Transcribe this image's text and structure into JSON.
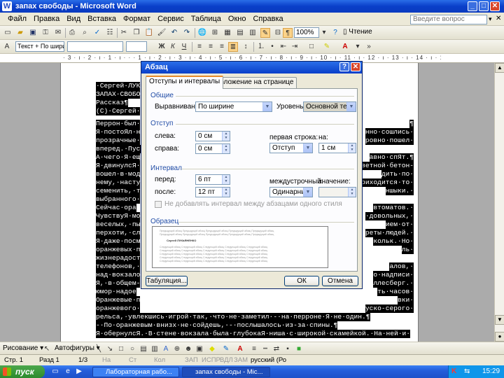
{
  "window": {
    "title": "запах свободы - Microsoft Word"
  },
  "menu": {
    "items": [
      "Файл",
      "Правка",
      "Вид",
      "Вставка",
      "Формат",
      "Сервис",
      "Таблица",
      "Окно",
      "Справка"
    ],
    "ask_placeholder": "Введите вопрос"
  },
  "toolbar": {
    "zoom": "100%",
    "reading": "Чтение",
    "style": "Текст + По шири"
  },
  "ruler": {
    "labels": "· 3 · ı · 2 · ı · 1 · ı · · · 1 · ı · 2 · ı · 3 · ı · 4 · ı · 5 · ı · 6 · ı · 7 · ı · 8 · ı · 9 · ı · 10 · ı · 11 · ı · 12 · ı · 13 · ı · 14 · ı · 15 · ı · 16 · ı · 18"
  },
  "document": {
    "lines": [
      {
        "text": "·Сергей·ЛУК",
        "sel": true
      },
      {
        "text": "ЗАПАХ·СВОБО",
        "sel": true
      },
      {
        "text": "Рассказ¶",
        "sel": true
      },
      {
        "text": "(С)·Сергей·",
        "sel": true
      },
      {
        "text": "Перрон·был·",
        "sel": true,
        "right": "¶"
      },
      {
        "text": "Я·постоЯл·н",
        "sel": true,
        "right": "нно·сошлись·"
      },
      {
        "text": "прозрачные·",
        "sel": true,
        "right": "ровно·пошел·"
      },
      {
        "text": "вперед.·Пуст",
        "sel": true,
        "right": ""
      },
      {
        "text": "А·чего·Я·ещ",
        "sel": true,
        "right": "авно·спЯт.¶"
      },
      {
        "text": "Я·двинулсЯ·",
        "sel": true,
        "right": "светной·бетон-"
      },
      {
        "text": "вошел·в·мод",
        "sel": true,
        "right": "дить·по·"
      },
      {
        "text": "нему,·насту",
        "sel": true,
        "right": "риходится·то·"
      },
      {
        "text": "семенить,·т",
        "sel": true,
        "right": "ншыки.·"
      },
      {
        "text": "выбранного·",
        "sel": true,
        "right": ""
      },
      {
        "text": "Сейчас·ора",
        "sel": true,
        "right": "втоматов.·"
      },
      {
        "text": "ЧувствуЯ·мо",
        "sel": true,
        "right": "·довольных,·"
      },
      {
        "text": "веселых,·пы",
        "sel": true,
        "right": "ием·от·"
      },
      {
        "text": "перхоти,·сл",
        "sel": true,
        "right": "реты·людей.·"
      },
      {
        "text": "Я·даже·посм",
        "sel": true,
        "right": "кольк.·Но·"
      },
      {
        "text": "оранжевых·п",
        "sel": true,
        "right": "ль·"
      },
      {
        "text": "жизнерадост",
        "sel": true,
        "right": ""
      },
      {
        "text": "телефонов,·",
        "sel": true,
        "right": "алов,·"
      },
      {
        "text": "над·вокзало",
        "sel": true,
        "right": "о·надписи·"
      },
      {
        "text": "Я,·в·общем-",
        "sel": true,
        "right": "ллесберг.·"
      },
      {
        "text": "юмор·надое",
        "sel": true,
        "right": "ть·часов·"
      },
      {
        "text": "Оранжевые·п",
        "sel": true,
        "right": "вки·"
      },
      {
        "text": "оранжевого·",
        "sel": true,
        "right": "уско-серого·"
      },
      {
        "text": "рельса,·увлекшись·игрой·так,·что·не·заметил·-·на·перроне·Я·не·один.¶",
        "sel": true,
        "right": ""
      },
      {
        "text": "-·По·оранжевым·внизх·не·сойдешь,·-·послышалось·из-за·спины.¶",
        "sel": true,
        "right": ""
      },
      {
        "text": "Я·обернулсЯ.·В·стене·вокзала·была·глубокаЯ·ниша·с·широкой·скамейкой.·На·ней·и·",
        "sel": true,
        "right": ""
      },
      {
        "text": "сидел·говоривший·-·мальчишка·моего·возраста,·судЯ·по·полосу.·Впрочем,·взрослого·Я·",
        "sel": true,
        "right": ""
      },
      {
        "text": "почувствовал·бы·по·запаху,·еще·только·выходЯ·из·вагона.·Взрослые·пахнут·сильно,·",
        "sel": true,
        "right": ""
      }
    ]
  },
  "dialog": {
    "title": "Абзац",
    "help": "?",
    "close": "✕",
    "tabs": [
      "Отступы и интервалы",
      "Положение на странице"
    ],
    "general": {
      "label": "Общие",
      "alignment_label": "Выравнивание:",
      "alignment": "По ширине",
      "level_label": "Уровень:",
      "level": "Основной текст"
    },
    "indent": {
      "label": "Отступ",
      "left_label": "слева:",
      "left": "0 см",
      "right_label": "справа:",
      "right": "0 см",
      "first_line_label": "первая строка:",
      "first_line": "Отступ",
      "by_label": "на:",
      "by": "1 см"
    },
    "spacing": {
      "label": "Интервал",
      "before_label": "перед:",
      "before": "6 пт",
      "after_label": "после:",
      "after": "12 пт",
      "line_label": "междустрочный:",
      "line": "Одинарный",
      "at_label": "значение:",
      "at": "",
      "no_space_label": "Не добавлять интервал между абзацами одного стиля"
    },
    "preview": {
      "label": "Образец",
      "prev": "Предыдущий абзац Предыдущий абзац Предыдущий абзац Предыдущий абзац Предыдущий абзац",
      "sample": "Сергей ЛУКЬЯНЕНКО",
      "next": "Следующий абзац Следующий абзац Следующий абзац Следующий абзац Следующий абзац"
    },
    "tabs_button": "Табуляция...",
    "ok": "ОК",
    "cancel": "Отмена"
  },
  "drawing": {
    "draw_label": "Рисование ▾",
    "autoshapes_label": "Автофигуры ▾"
  },
  "status": {
    "page": "Стр.  1",
    "section": "Разд  1",
    "pages": "1/3",
    "at": "На",
    "line": "Ст",
    "col": "Кол",
    "rec": "ЗАП",
    "trk": "ИСПР",
    "ext": "ВДЛ",
    "ovr": "ЗАМ",
    "lang": "русский (Ро"
  },
  "taskbar": {
    "start": "пуск",
    "tasks": [
      "Лабораторная рабо...",
      "запах свободы - Mic..."
    ],
    "clock": "15:29"
  }
}
